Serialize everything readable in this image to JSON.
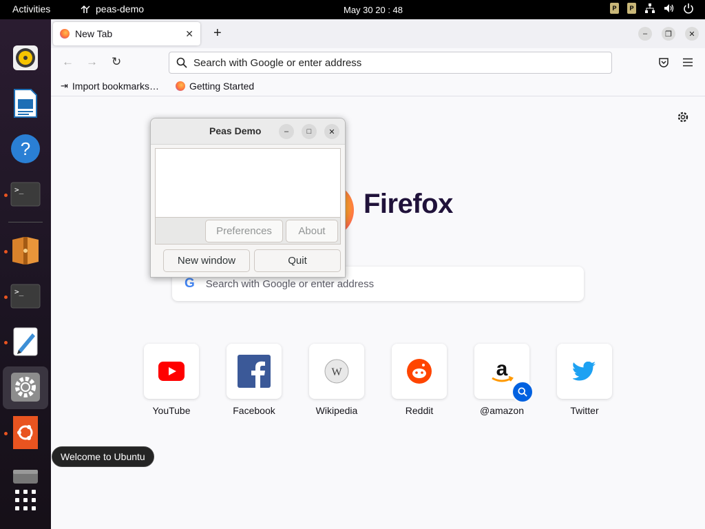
{
  "topbar": {
    "activities": "Activities",
    "app_name": "peas-demo",
    "clock": "May 30  20 : 48",
    "tray_p1": "P",
    "tray_p2": "P"
  },
  "dock": {
    "tooltip": "Welcome to Ubuntu"
  },
  "firefox": {
    "tab_title": "New Tab",
    "url_placeholder": "Search with Google or enter address",
    "bookmarks": [
      "Import bookmarks…",
      "Getting Started"
    ],
    "brand": "Firefox",
    "search_placeholder": "Search with Google or enter address",
    "shortcuts": [
      {
        "label": "YouTube"
      },
      {
        "label": "Facebook"
      },
      {
        "label": "Wikipedia"
      },
      {
        "label": "Reddit"
      },
      {
        "label": "@amazon"
      },
      {
        "label": "Twitter"
      }
    ]
  },
  "peas_demo": {
    "title": "Peas Demo",
    "preferences": "Preferences",
    "about": "About",
    "new_window": "New window",
    "quit": "Quit"
  },
  "colors": {
    "ubuntu_orange": "#e95420",
    "firefox_purple": "#20123a",
    "youtube_red": "#ff0000",
    "facebook_blue": "#3b5998",
    "reddit_orange": "#ff4500",
    "twitter_blue": "#1da1f2"
  }
}
